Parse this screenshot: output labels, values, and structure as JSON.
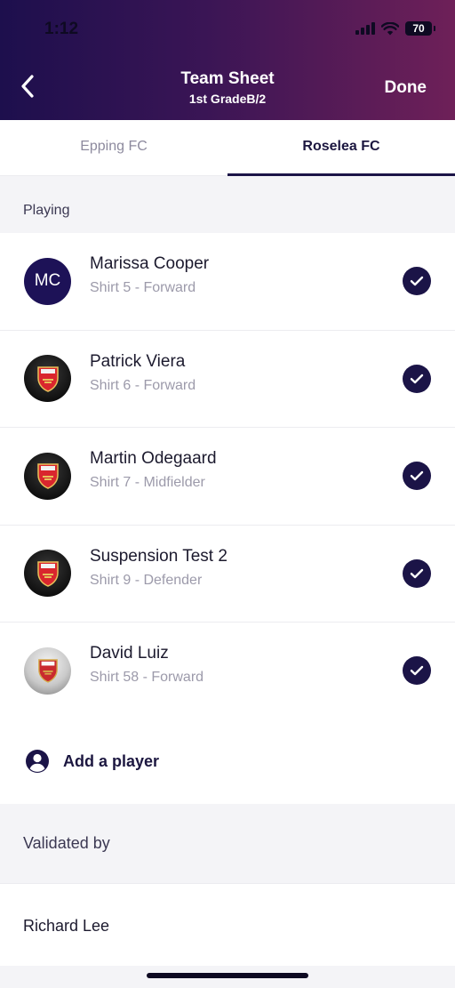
{
  "status_bar": {
    "time": "1:12",
    "battery": "70"
  },
  "header": {
    "title": "Team Sheet",
    "subtitle": "1st GradeB/2",
    "done_label": "Done"
  },
  "tabs": [
    {
      "label": "Epping FC",
      "active": false
    },
    {
      "label": "Roselea FC",
      "active": true
    }
  ],
  "section": {
    "playing_label": "Playing"
  },
  "players": [
    {
      "name": "Marissa Cooper",
      "detail": "Shirt 5 - Forward",
      "initials": "MC",
      "avatar": "initials",
      "checked": true
    },
    {
      "name": "Patrick Viera",
      "detail": "Shirt 6 - Forward",
      "avatar": "arsenal-crest-icon",
      "checked": true
    },
    {
      "name": "Martin Odegaard",
      "detail": "Shirt 7 - Midfielder",
      "avatar": "arsenal-crest-icon",
      "checked": true
    },
    {
      "name": "Suspension Test 2",
      "detail": "Shirt 9 - Defender",
      "avatar": "arsenal-crest-icon",
      "checked": true
    },
    {
      "name": "David Luiz",
      "detail": "Shirt 58 - Forward",
      "avatar": "arsenal-crest-icon",
      "checked": true
    }
  ],
  "add_player": {
    "label": "Add a player",
    "icon": "user-circle-icon"
  },
  "validation": {
    "label": "Validated by",
    "name": "Richard Lee"
  },
  "colors": {
    "header_start": "#1d0f4d",
    "header_end": "#6e2058",
    "accent": "#1b1447"
  }
}
